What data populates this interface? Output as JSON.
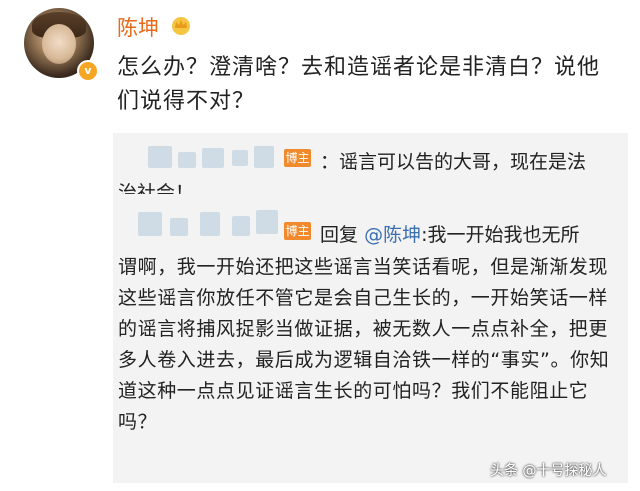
{
  "post": {
    "username": "陈坤",
    "verified_badge": "v",
    "text": "怎么办？澄清啥？去和造谣者论是非清白？说他们说得不对？"
  },
  "quote": {
    "tag": "博主",
    "comment_line1": "：谣言可以告的大哥，现在是法",
    "comment_line2": "治社会！",
    "reply_prefix": "回复",
    "reply_mention": "@陈坤",
    "reply_first": ":我一开始我也无所",
    "reply_body": "谓啊，我一开始还把这些谣言当笑话看呢，但是渐渐发现这些谣言你放任不管它是会自己生长的，一开始笑话一样的谣言将捕风捉影当做证据，被无数人一点点补全，把更多人卷入进去，最后成为逻辑自洽铁一样的“事实”。你知道这种一点点见证谣言生长的可怕吗？我们不能阻止它吗？"
  },
  "watermark": "头条 @十号探秘人",
  "icons": {
    "crown": "crown-icon",
    "verified": "verified-icon"
  }
}
